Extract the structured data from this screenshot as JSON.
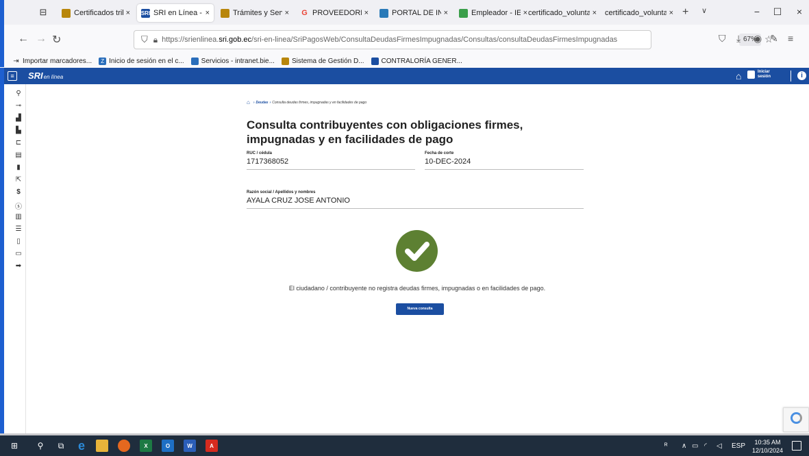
{
  "browser": {
    "tabs": [
      {
        "title": "Certificados trib",
        "active": false,
        "fav_text": "",
        "fav_color": "#b8860b"
      },
      {
        "title": "SRI en Línea - Co",
        "active": true,
        "fav_text": "SRI",
        "fav_color": "#1b4ea1"
      },
      {
        "title": "Trámites y Servic",
        "active": false,
        "fav_text": "",
        "fav_color": "#b8860b"
      },
      {
        "title": "PROVEEDORES I",
        "active": false,
        "fav_text": "G",
        "fav_color": "#ffffff"
      },
      {
        "title": "PORTAL DE INFO",
        "active": false,
        "fav_text": "",
        "fav_color": "#2a7ab8"
      },
      {
        "title": "Empleador - IES",
        "active": false,
        "fav_text": "",
        "fav_color": "#3a9e4a"
      },
      {
        "title": "certificado_voluntar",
        "active": false,
        "fav_text": "",
        "fav_color": ""
      },
      {
        "title": "certificado_voluntar",
        "active": false,
        "fav_text": "",
        "fav_color": ""
      }
    ],
    "url_prefix": "https://srienlinea.",
    "url_host": "sri.gob.ec",
    "url_path": "/sri-en-linea/SriPagosWeb/ConsultaDeudasFirmesImpugnadas/Consultas/consultaDeudasFirmesImpugnadas",
    "zoom": "67%",
    "bookmarks": [
      {
        "label": "Importar marcadores...",
        "icon": "import-icon",
        "color": ""
      },
      {
        "label": "Inicio de sesión en el c...",
        "icon": "z-icon",
        "color": "#2a6ebb"
      },
      {
        "label": "Servicios - intranet.bie...",
        "icon": "intranet-icon",
        "color": "#2a6ebb"
      },
      {
        "label": "Sistema de Gestión D...",
        "icon": "emblem-icon",
        "color": "#b8860b"
      },
      {
        "label": "CONTRALORÍA GENER...",
        "icon": "contraloria-icon",
        "color": "#1b4ea1"
      }
    ]
  },
  "sri_header": {
    "logo": "SRI",
    "logo_sub": "en línea",
    "login_line1": "Iniciar",
    "login_line2": "sesión"
  },
  "breadcrumb": {
    "link": "Deudas",
    "current": "Consulta deudas firmes, impugnadas y en facilidades de pago"
  },
  "page": {
    "title": "Consulta contribuyentes con obligaciones firmes, impugnadas y en facilidades de pago",
    "ruc_label": "RUC / cédula",
    "ruc_value": "1717368052",
    "fecha_label": "Fecha de corte",
    "fecha_value": "10-DEC-2024",
    "razon_label": "Razón social / Apellidos y nombres",
    "razon_value": "AYALA CRUZ JOSE ANTONIO",
    "message": "El ciudadano / contribuyente no registra deudas firmes, impugnadas o en facilidades de pago.",
    "button": "Nueva consulta",
    "success_color": "#5d8032"
  },
  "taskbar": {
    "language": "ESP",
    "time": "10:35 AM",
    "date": "12/10/2024"
  },
  "colors": {
    "sri_blue": "#1b4ea1",
    "taskbar": "#1f2d3d"
  }
}
